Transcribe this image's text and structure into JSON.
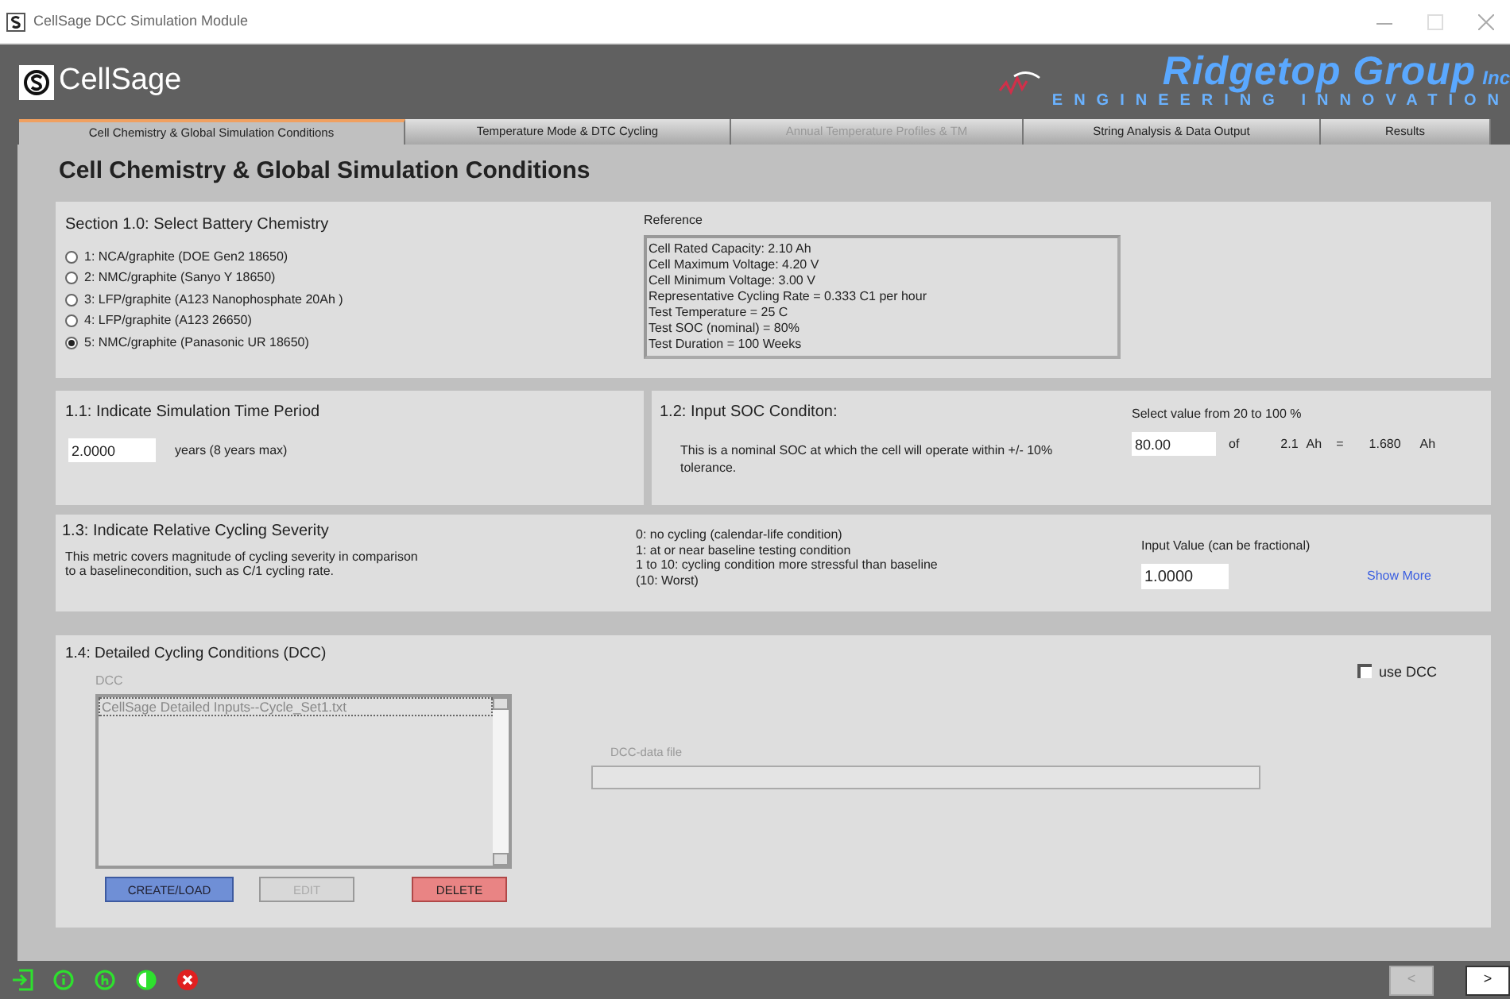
{
  "window": {
    "title": "CellSage DCC Simulation Module"
  },
  "header": {
    "logo_text": "CellSage",
    "company": "Ridgetop Group",
    "company_suffix": "Inc",
    "tagline": "ENGINEERING INNOVATION"
  },
  "tabs": [
    {
      "label": "Cell Chemistry & Global Simulation Conditions",
      "selected": true,
      "disabled": false
    },
    {
      "label": "Temperature Mode & DTC Cycling",
      "selected": false,
      "disabled": false
    },
    {
      "label": "Annual Temperature Profiles & TM",
      "selected": false,
      "disabled": true
    },
    {
      "label": "String Analysis & Data Output",
      "selected": false,
      "disabled": false
    },
    {
      "label": "Results",
      "selected": false,
      "disabled": false
    }
  ],
  "page_title": "Cell Chemistry & Global Simulation Conditions",
  "section_1_0": {
    "title": "Section 1.0:  Select Battery Chemistry",
    "options": [
      {
        "label": "1: NCA/graphite (DOE Gen2 18650)",
        "selected": false
      },
      {
        "label": "2: NMC/graphite (Sanyo Y 18650)",
        "selected": false
      },
      {
        "label": "3: LFP/graphite (A123 Nanophosphate 20Ah )",
        "selected": false
      },
      {
        "label": "4: LFP/graphite (A123 26650)",
        "selected": false
      },
      {
        "label": "5: NMC/graphite (Panasonic UR 18650)",
        "selected": true
      }
    ],
    "reference": {
      "label": "Reference",
      "lines": [
        "Cell Rated Capacity: 2.10 Ah",
        "Cell Maximum Voltage: 4.20 V",
        "Cell Minimum Voltage: 3.00 V",
        "Representative Cycling Rate = 0.333 C1 per hour",
        "Test Temperature = 25 C",
        "Test SOC (nominal) = 80%",
        "Test Duration = 100 Weeks"
      ]
    }
  },
  "section_1_1": {
    "title": "1.1: Indicate Simulation Time Period",
    "value": "2.0000",
    "unit": "years (8 years max)"
  },
  "section_1_2": {
    "title": "1.2: Input SOC Conditon:",
    "description": "This is a nominal SOC at which the cell will operate within +/- 10% tolerance.",
    "range_label": "Select value from 20 to 100 %",
    "value": "80.00",
    "of_label": "of",
    "capacity": "2.1",
    "capacity_unit": "Ah",
    "equals": "=",
    "result": "1.680",
    "result_unit": "Ah"
  },
  "section_1_3": {
    "title": "1.3: Indicate Relative Cycling Severity",
    "description": "This metric covers magnitude of cycling severity in comparison to a baselinecondition, such as C/1 cycling rate.",
    "scale_lines": [
      "0: no cycling (calendar-life condition)",
      "1: at or near baseline testing condition",
      "1 to 10: cycling condition more stressful than baseline",
      "(10: Worst)"
    ],
    "input_label": "Input Value (can be fractional)",
    "value": "1.0000",
    "link": "Show More"
  },
  "section_1_4": {
    "title": "1.4: Detailed Cycling Conditions (DCC)",
    "use_dcc": {
      "label": "use DCC",
      "checked": false
    },
    "list_label": "DCC",
    "list_items": [
      {
        "label": "CellSage Detailed Inputs--Cycle_Set1.txt",
        "selected": true
      }
    ],
    "file_label": "DCC-data file",
    "buttons": [
      {
        "label": "CREATE/LOAD",
        "kind": "primary",
        "disabled": false
      },
      {
        "label": "EDIT",
        "kind": "normal",
        "disabled": true
      },
      {
        "label": "DELETE",
        "kind": "danger",
        "disabled": false
      }
    ]
  },
  "footer": {
    "nav": [
      {
        "label": "<",
        "disabled": true
      },
      {
        "label": ">",
        "disabled": false
      }
    ]
  }
}
